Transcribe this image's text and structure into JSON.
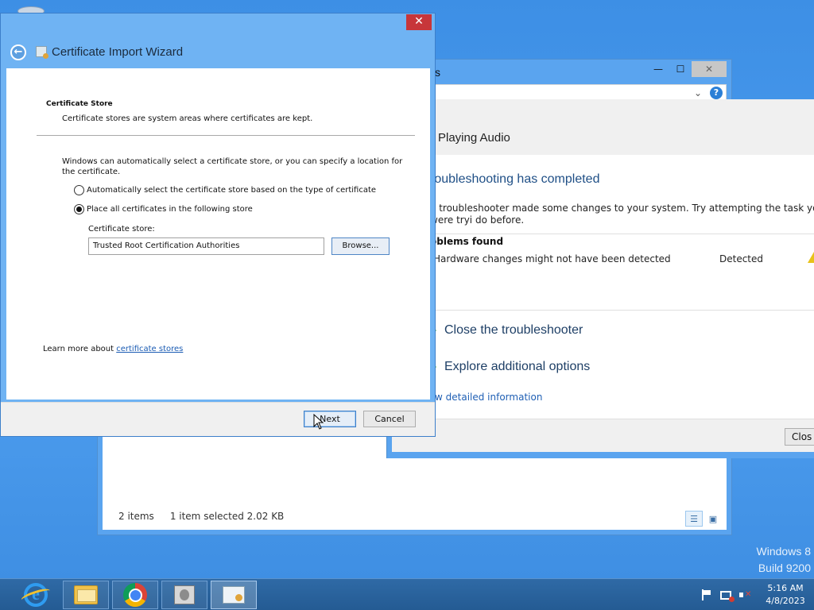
{
  "desktop": {
    "watermark_line1": "Windows 8",
    "watermark_line2": "Build 9200"
  },
  "explorer": {
    "title_fragment": "s",
    "status_items": "2 items",
    "status_selected": "1 item selected  2.02 KB",
    "minimize_glyph": "—",
    "maximize_glyph": "☐",
    "close_glyph": "✕",
    "chevron_glyph": "⌄",
    "help_glyph": "?"
  },
  "troubleshooter": {
    "heading": "Playing Audio",
    "completed": "roubleshooting has completed",
    "description": "e troubleshooter made some changes to your system. Try attempting the task you were tryi do before.",
    "problems_header": "oblems found",
    "problem_text": "Hardware changes might not have been detected",
    "problem_status": "Detected",
    "option_close": "Close the troubleshooter",
    "option_explore": "Explore additional options",
    "details_link": "w detailed information",
    "close_button": "Clos"
  },
  "wizard": {
    "title": "Certificate Import Wizard",
    "close_glyph": "✕",
    "back_glyph": "←",
    "section_title": "Certificate Store",
    "section_desc": "Certificate stores are system areas where certificates are kept.",
    "paragraph": "Windows can automatically select a certificate store, or you can specify a location for the certificate.",
    "radio_auto": "Automatically select the certificate store based on the type of certificate",
    "radio_place": "Place all certificates in the following store",
    "selected_option": "place",
    "store_label": "Certificate store:",
    "store_value": "Trusted Root Certification Authorities",
    "browse_button": "Browse...",
    "learn_prefix": "Learn more about ",
    "learn_link": "certificate stores",
    "next_button": "Next",
    "cancel_button": "Cancel"
  },
  "taskbar": {
    "items": [
      "internet-explorer",
      "file-explorer",
      "chrome",
      "disk-utility",
      "certificate"
    ],
    "time": "5:16 AM",
    "date": "4/8/2023"
  },
  "colors": {
    "desktop": "#3d8fe5",
    "window_frame": "#6fb3f3",
    "close_red": "#c7363a",
    "link_blue": "#1a5bb3",
    "warning_yellow": "#e8c21a"
  }
}
